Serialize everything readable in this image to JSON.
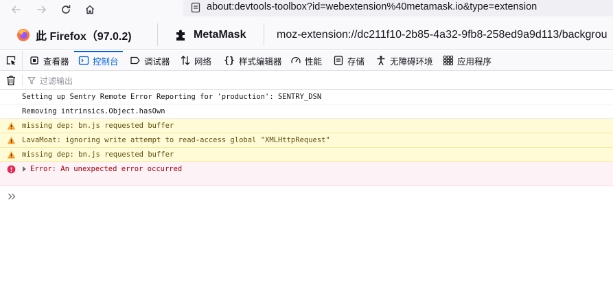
{
  "nav": {
    "url": "about:devtools-toolbox?id=webextension%40metamask.io&type=extension"
  },
  "target": {
    "browser_label": "此 Firefox（97.0.2)",
    "extension_label": "MetaMask",
    "page_url": "moz-extension://dc211f10-2b85-4a32-9fb8-258ed9a9d113/backgrou"
  },
  "tabs": [
    {
      "label": "查看器",
      "icon": "inspector-icon"
    },
    {
      "label": "控制台",
      "icon": "console-icon",
      "selected": true
    },
    {
      "label": "调试器",
      "icon": "debugger-icon"
    },
    {
      "label": "网络",
      "icon": "network-icon"
    },
    {
      "label": "样式编辑器",
      "icon": "style-editor-icon"
    },
    {
      "label": "性能",
      "icon": "performance-icon"
    },
    {
      "label": "存储",
      "icon": "storage-icon"
    },
    {
      "label": "无障碍环境",
      "icon": "accessibility-icon"
    },
    {
      "label": "应用程序",
      "icon": "application-icon"
    }
  ],
  "filter": {
    "placeholder": "过滤输出"
  },
  "messages": [
    {
      "level": "log",
      "text": "Setting up Sentry Remote Error Reporting for 'production': SENTRY_DSN"
    },
    {
      "level": "log",
      "text": "Removing intrinsics.Object.hasOwn"
    },
    {
      "level": "warn",
      "text": "missing dep: bn.js requested buffer"
    },
    {
      "level": "warn",
      "text": "LavaMoat: ignoring write attempt to read-access global \"XMLHttpRequest\""
    },
    {
      "level": "warn",
      "text": "missing dep: bn.js requested buffer"
    },
    {
      "level": "error",
      "text": "Error: An unexpected error occurred"
    }
  ],
  "colors": {
    "accent": "#0061e0",
    "warn_bg": "#fffbd6",
    "error_bg": "#fdf2f5",
    "warn_icon": "#ffa436",
    "error_icon": "#e22850"
  }
}
